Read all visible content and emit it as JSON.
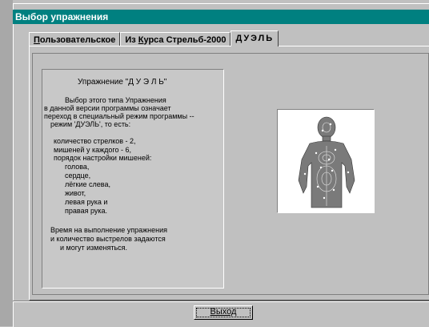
{
  "window": {
    "title": "Выбор упражнения"
  },
  "tabs": [
    {
      "label_pre": "",
      "label_u": "П",
      "label_post": "ользовательское"
    },
    {
      "label_pre": "Из ",
      "label_u": "К",
      "label_post": "урса Стрельб-2000"
    },
    {
      "label_pre": "",
      "label_u": "",
      "label_post": "ДУЭЛЬ"
    }
  ],
  "description": {
    "lines": [
      "Упражнение \"Д У Э Л Ь\"",
      "",
      "Выбор этого типа Упражнения",
      "в данной версии программы означает",
      "переход в специальный режим программы --",
      "режим 'ДУЭЛЬ', то есть:",
      "",
      "количество стрелков - 2,",
      "мишеней у каждого - 6,",
      "порядок настройки мишеней:",
      "голова,",
      "сердце,",
      "лёгкие слева,",
      "живот,",
      "левая рука и",
      "правая рука.",
      "",
      "Время на выполнение упражнения",
      "и количество выстрелов задаются",
      "и могут изменяться."
    ]
  },
  "target_image": {
    "icon": "human-silhouette-target",
    "fill_color": "#7a7a7a"
  },
  "footer": {
    "exit_button": "Выход"
  }
}
